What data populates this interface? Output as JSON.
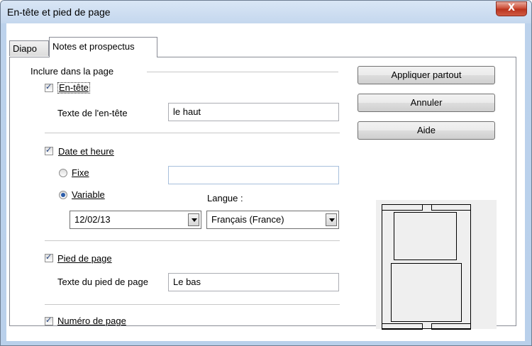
{
  "window": {
    "title": "En-tête et pied de page",
    "close_glyph": "X"
  },
  "tabs": [
    {
      "label": "Diapo"
    },
    {
      "label": "Notes et prospectus"
    }
  ],
  "include_group": {
    "label": "Inclure dans la page"
  },
  "header": {
    "checkbox_label": "En-tête",
    "checked": true,
    "text_label": "Texte de l'en-tête",
    "text_value": "le haut"
  },
  "date_time": {
    "checkbox_label": "Date et heure",
    "checked": true,
    "fixed_label": "Fixe",
    "fixed_value": "",
    "variable_label": "Variable",
    "variable_selected": true,
    "format_value": "12/02/13",
    "language_label": "Langue :",
    "language_value": "Français (France)"
  },
  "footer": {
    "checkbox_label": "Pied de page",
    "checked": true,
    "text_label": "Texte du pied de page",
    "text_value": "Le bas"
  },
  "page_number": {
    "checkbox_label": "Numéro de page",
    "checked": true
  },
  "buttons": {
    "apply_all": "Appliquer partout",
    "cancel": "Annuler",
    "help": "Aide"
  },
  "check_glyph": "✓"
}
